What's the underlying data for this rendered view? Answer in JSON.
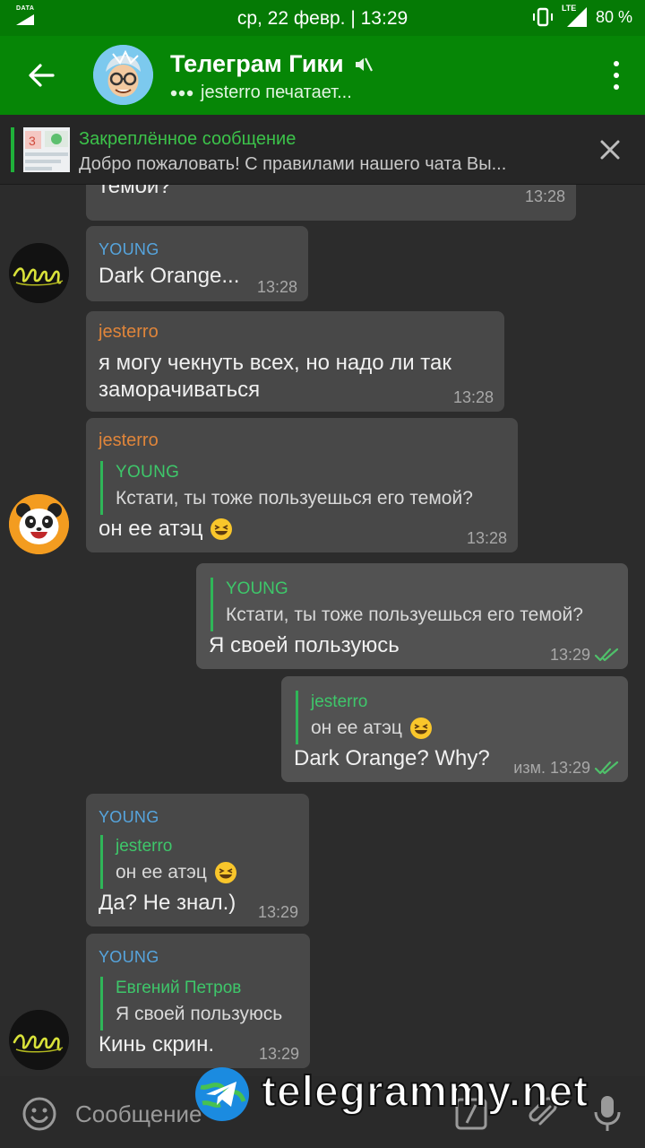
{
  "status_bar": {
    "data_label": "DATA",
    "clock": "ср, 22 февр. | 13:29",
    "network": "LTE",
    "battery": "80 %"
  },
  "header": {
    "title": "Телеграм Гики",
    "status": "jesterro печатает...",
    "muted": true
  },
  "pinned": {
    "title": "Закреплённое сообщение",
    "text": "Добро пожаловать! С правилами нашего чата Вы..."
  },
  "messages": [
    {
      "id": "m0",
      "text": "темой?",
      "time": "13:28"
    },
    {
      "id": "m1",
      "sender": "YOUNG",
      "text": "Dark Orange...",
      "time": "13:28"
    },
    {
      "id": "m2",
      "sender": "jesterro",
      "text_line1": "я могу чекнуть всех, но надо ли так",
      "text_line2": "заморачиваться",
      "time": "13:28"
    },
    {
      "id": "m3",
      "sender": "jesterro",
      "reply_name": "YOUNG",
      "reply_text": "Кстати, ты тоже пользуешься его темой?",
      "text": "он ее атэц",
      "time": "13:28"
    },
    {
      "id": "m4",
      "outgoing": true,
      "reply_name": "YOUNG",
      "reply_text": "Кстати, ты тоже пользуешься его темой?",
      "text": "Я своей пользуюсь",
      "time": "13:29"
    },
    {
      "id": "m5",
      "outgoing": true,
      "reply_name": "jesterro",
      "reply_text": "он ее атэц",
      "text": "Dark Orange? Why?",
      "time": "изм. 13:29"
    },
    {
      "id": "m6",
      "sender": "YOUNG",
      "reply_name": "jesterro",
      "reply_text": "он ее атэц",
      "text": "Да? Не знал.)",
      "time": "13:29"
    },
    {
      "id": "m7",
      "sender": "YOUNG",
      "reply_name": "Евгений Петров",
      "reply_text": "Я своей пользуюсь",
      "text": "Кинь скрин.",
      "time": "13:29"
    }
  ],
  "input": {
    "placeholder": "Сообщение"
  },
  "watermark": {
    "text": "telegrammy.net"
  },
  "colors": {
    "header": "#068606",
    "status_bar": "#057a05",
    "background": "#2c2c2c",
    "bubble": "#484848",
    "accent_green": "#3ec76a",
    "young_name": "#56a5de",
    "jesterro_name": "#e0853a"
  }
}
